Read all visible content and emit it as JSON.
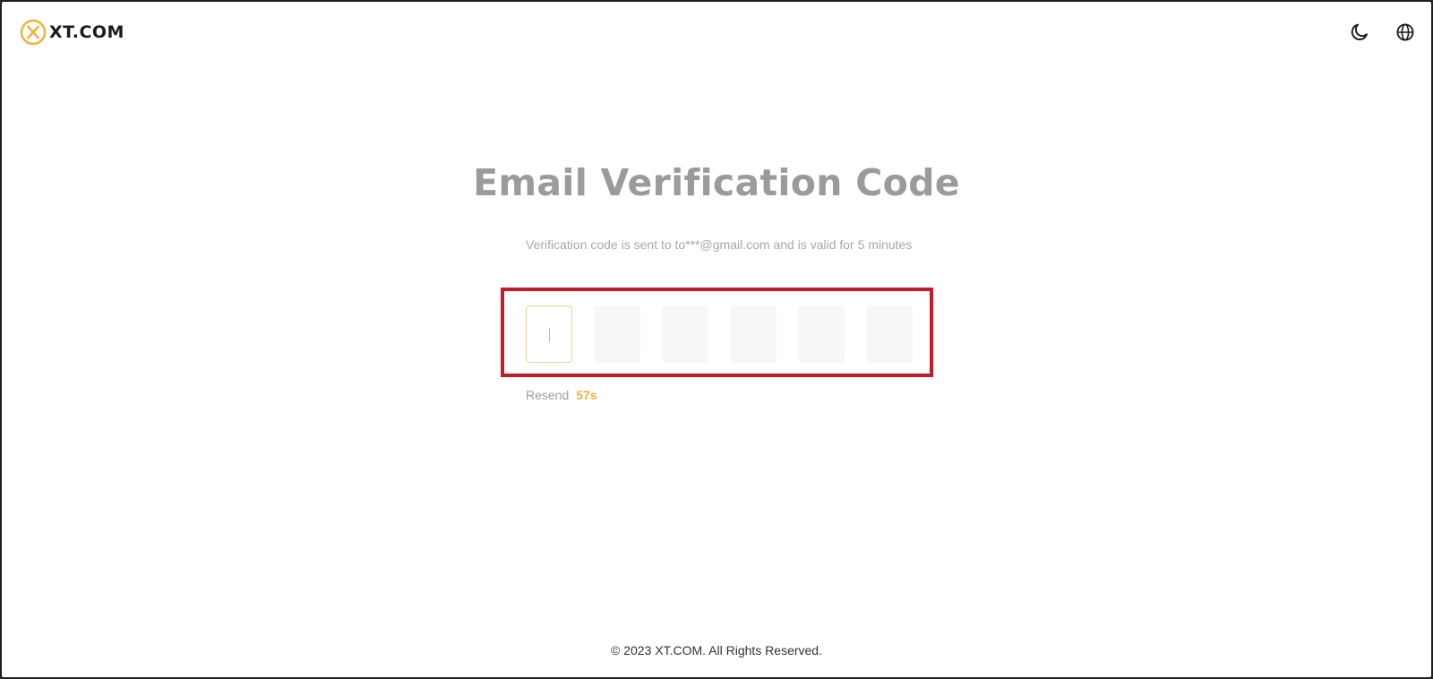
{
  "header": {
    "logo_text": "XT.COM",
    "theme_icon": "moon-icon",
    "language_icon": "globe-icon"
  },
  "main": {
    "title": "Email Verification Code",
    "hint": "Verification code is sent to to***@gmail.com and is valid for 5 minutes",
    "code_inputs": [
      "",
      "",
      "",
      "",
      "",
      ""
    ],
    "resend_label": "Resend",
    "countdown": "57s"
  },
  "footer": {
    "copyright": "© 2023 XT.COM. All Rights Reserved."
  },
  "colors": {
    "brand": "#f0b33a",
    "highlight": "#c8192a",
    "title": "#9b9b9b"
  }
}
